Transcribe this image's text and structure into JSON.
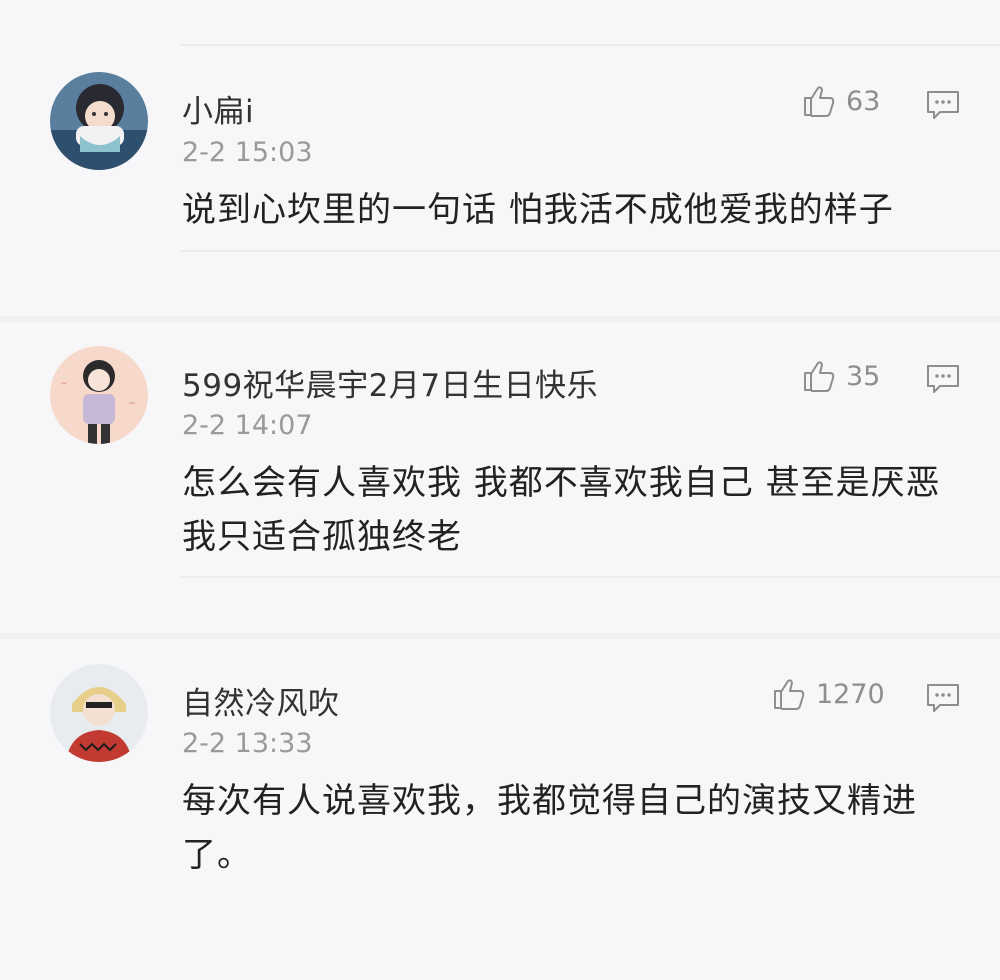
{
  "comments": [
    {
      "username": "小扁i",
      "time": "2-2 15:03",
      "likes": "63",
      "text": "说到心坎里的一句话 怕我活不成他爱我的样子",
      "avatar_icon": "avatar-anime-girl-scarf",
      "avatar_color": "#3c6a8f"
    },
    {
      "username": "599祝华晨宇2月7日生日快乐",
      "time": "2-2 14:07",
      "likes": "35",
      "text": "怎么会有人喜欢我 我都不喜欢我自己 甚至是厌恶我只适合孤独终老",
      "avatar_icon": "avatar-illustrated-boy",
      "avatar_color": "#f3c8b8"
    },
    {
      "username": "自然冷风吹",
      "time": "2-2 13:33",
      "likes": "1270",
      "text": "每次有人说喜欢我，我都觉得自己的演技又精进了。",
      "avatar_icon": "avatar-anime-boy-red",
      "avatar_color": "#c23a32"
    }
  ],
  "icons": {
    "like": "thumbs-up-icon",
    "reply": "comment-bubble-icon"
  },
  "colors": {
    "background": "#f7f6f9",
    "meta_text": "#9a9a9a",
    "body_text": "#222222"
  }
}
